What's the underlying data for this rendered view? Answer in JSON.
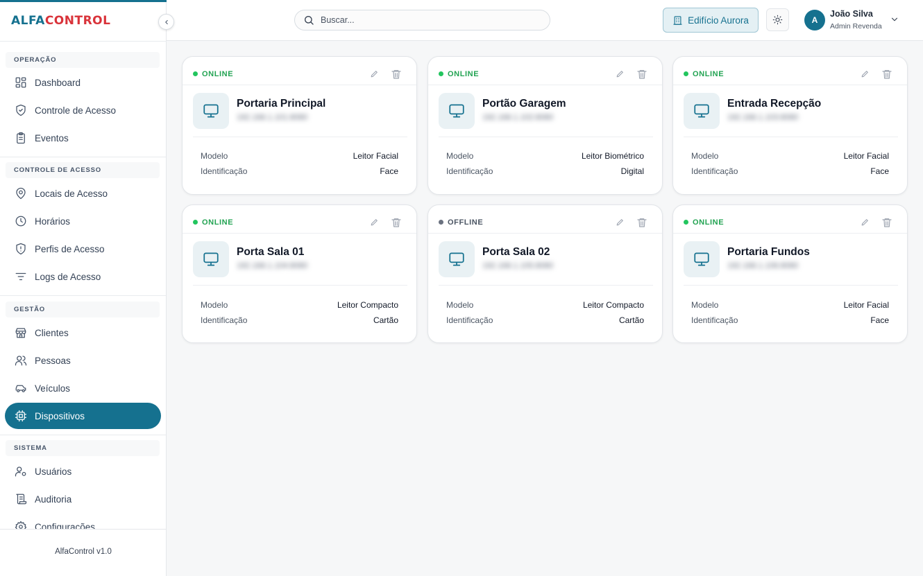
{
  "brand": {
    "part1": "ALFA",
    "part2": "CONTROL",
    "version": "AlfaControl v1.0"
  },
  "sidebar": {
    "sections": [
      {
        "title": "OPERAÇÃO",
        "items": [
          {
            "label": "Dashboard",
            "icon": "dashboard-icon"
          },
          {
            "label": "Controle de Acesso",
            "icon": "shield-check-icon"
          },
          {
            "label": "Eventos",
            "icon": "clipboard-list-icon"
          }
        ]
      },
      {
        "title": "CONTROLE DE ACESSO",
        "items": [
          {
            "label": "Locais de Acesso",
            "icon": "map-pin-icon"
          },
          {
            "label": "Horários",
            "icon": "clock-icon"
          },
          {
            "label": "Perfis de Acesso",
            "icon": "shield-alert-icon"
          },
          {
            "label": "Logs de Acesso",
            "icon": "filter-lines-icon"
          }
        ]
      },
      {
        "title": "GESTÃO",
        "items": [
          {
            "label": "Clientes",
            "icon": "store-icon"
          },
          {
            "label": "Pessoas",
            "icon": "users-icon"
          },
          {
            "label": "Veículos",
            "icon": "car-icon"
          },
          {
            "label": "Dispositivos",
            "icon": "cpu-icon",
            "active": true
          }
        ]
      },
      {
        "title": "SISTEMA",
        "items": [
          {
            "label": "Usuários",
            "icon": "user-cog-icon"
          },
          {
            "label": "Auditoria",
            "icon": "scroll-icon"
          },
          {
            "label": "Configurações",
            "icon": "settings-icon"
          }
        ]
      }
    ]
  },
  "topbar": {
    "search_placeholder": "Buscar...",
    "building": "Edifício Aurora",
    "user": {
      "initial": "A",
      "name": "João Silva",
      "role": "Admin Revenda"
    }
  },
  "labels": {
    "model": "Modelo",
    "identification": "Identificação"
  },
  "devices": [
    {
      "status": "ONLINE",
      "online": true,
      "name": "Portaria Principal",
      "ip": "192.168.1.101:8080",
      "model": "Leitor Facial",
      "identification": "Face"
    },
    {
      "status": "ONLINE",
      "online": true,
      "name": "Portão Garagem",
      "ip": "192.168.1.102:8080",
      "model": "Leitor Biométrico",
      "identification": "Digital"
    },
    {
      "status": "ONLINE",
      "online": true,
      "name": "Entrada Recepção",
      "ip": "192.168.1.103:8080",
      "model": "Leitor Facial",
      "identification": "Face"
    },
    {
      "status": "ONLINE",
      "online": true,
      "name": "Porta Sala 01",
      "ip": "192.168.1.104:8080",
      "model": "Leitor Compacto",
      "identification": "Cartão"
    },
    {
      "status": "OFFLINE",
      "online": false,
      "name": "Porta Sala 02",
      "ip": "192.168.1.105:8080",
      "model": "Leitor Compacto",
      "identification": "Cartão"
    },
    {
      "status": "ONLINE",
      "online": true,
      "name": "Portaria Fundos",
      "ip": "192.168.1.106:8080",
      "model": "Leitor Facial",
      "identification": "Face"
    }
  ],
  "colors": {
    "primary": "#15718f",
    "brand_red": "#d9333a",
    "online": "#22c55e",
    "offline": "#6b7280"
  }
}
